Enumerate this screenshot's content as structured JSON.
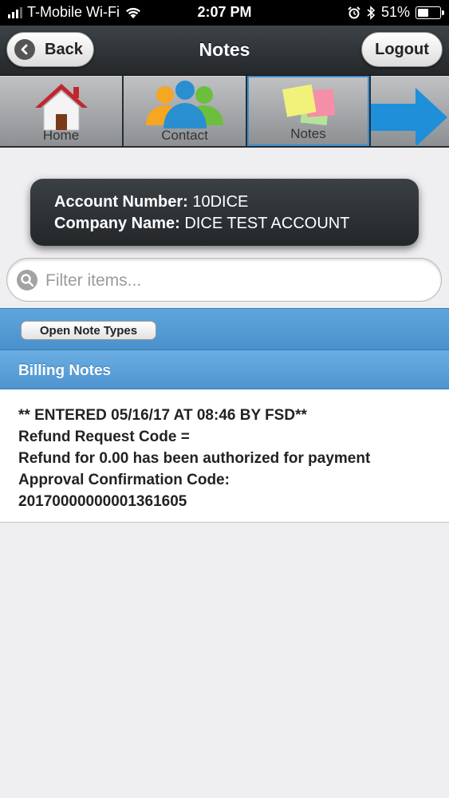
{
  "status_bar": {
    "carrier": "T-Mobile Wi-Fi",
    "time": "2:07 PM",
    "battery": "51%",
    "battery_level": 0.51,
    "icons": [
      "signal-icon",
      "wifi-icon",
      "alarm-icon",
      "bluetooth-icon",
      "battery-icon"
    ]
  },
  "header": {
    "title": "Notes",
    "back_label": "Back",
    "logout_label": "Logout"
  },
  "nav": {
    "items": [
      {
        "label": "Home",
        "icon": "home-icon"
      },
      {
        "label": "Contact",
        "icon": "contacts-icon"
      },
      {
        "label": "Notes",
        "icon": "sticky-notes-icon"
      },
      {
        "label": "",
        "icon": "arrow-right-icon"
      }
    ]
  },
  "account": {
    "number_label": "Account Number:",
    "number_value": "10DICE",
    "company_label": "Company Name:",
    "company_value": "DICE TEST ACCOUNT"
  },
  "search": {
    "placeholder": "Filter items...",
    "value": ""
  },
  "toolbar": {
    "open_note_types_label": "Open Note Types"
  },
  "section": {
    "title": "Billing Notes"
  },
  "notes": [
    {
      "lines": [
        "** ENTERED 05/16/17 AT 08:46 BY FSD**",
        "Refund Request Code =",
        "Refund for 0.00 has been authorized for payment",
        "Approval Confirmation Code:",
        "20170000000001361605"
      ]
    }
  ],
  "colors": {
    "header_bg": "#2d3236",
    "accent_blue": "#4a90cc",
    "page_bg": "#efeff1"
  }
}
